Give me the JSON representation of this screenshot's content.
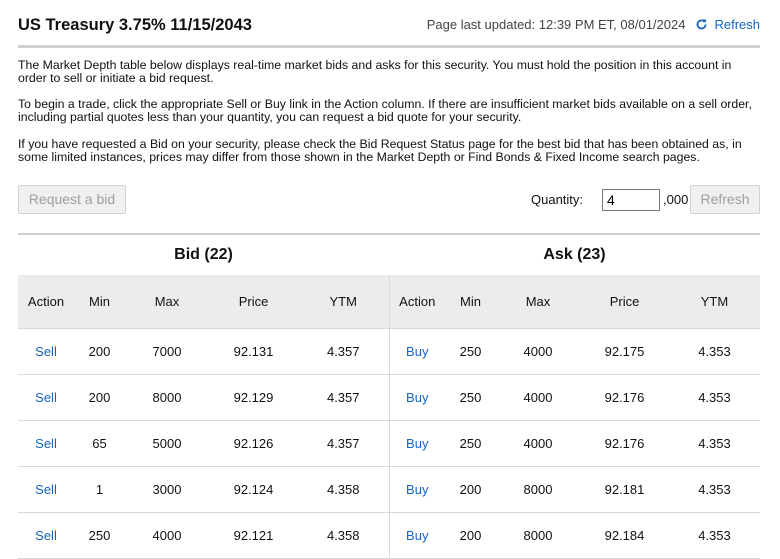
{
  "header": {
    "title": "US Treasury 3.75% 11/15/2043",
    "last_updated": "Page last updated: 12:39 PM ET, 08/01/2024",
    "refresh_label": "Refresh"
  },
  "intro": {
    "p1": "The Market Depth table below displays real-time market bids and asks for this security. You must hold the position in this account in order to sell or initiate a bid request.",
    "p2": "To begin a trade, click the appropriate Sell or Buy link in the Action column. If there are insufficient market bids available on a sell order, including partial quotes less than your quantity, you can request a bid quote for your security.",
    "p3": "If you have requested a Bid on your security, please check the Bid Request Status page for the best bid that has been obtained as, in some limited instances, prices may differ from those shown in the Market Depth or Find Bonds & Fixed Income search pages."
  },
  "controls": {
    "request_bid_label": "Request a bid",
    "quantity_label": "Quantity:",
    "quantity_value": "4",
    "quantity_suffix": ",000",
    "refresh_button_label": "Refresh"
  },
  "bid": {
    "heading": "Bid (22)",
    "columns": [
      "Action",
      "Min",
      "Max",
      "Price",
      "YTM"
    ],
    "rows": [
      {
        "action": "Sell",
        "min": "200",
        "max": "7000",
        "price": "92.131",
        "ytm": "4.357"
      },
      {
        "action": "Sell",
        "min": "200",
        "max": "8000",
        "price": "92.129",
        "ytm": "4.357"
      },
      {
        "action": "Sell",
        "min": "65",
        "max": "5000",
        "price": "92.126",
        "ytm": "4.357"
      },
      {
        "action": "Sell",
        "min": "1",
        "max": "3000",
        "price": "92.124",
        "ytm": "4.358"
      },
      {
        "action": "Sell",
        "min": "250",
        "max": "4000",
        "price": "92.121",
        "ytm": "4.358"
      }
    ]
  },
  "ask": {
    "heading": "Ask (23)",
    "columns": [
      "Action",
      "Min",
      "Max",
      "Price",
      "YTM"
    ],
    "rows": [
      {
        "action": "Buy",
        "min": "250",
        "max": "4000",
        "price": "92.175",
        "ytm": "4.353"
      },
      {
        "action": "Buy",
        "min": "250",
        "max": "4000",
        "price": "92.176",
        "ytm": "4.353"
      },
      {
        "action": "Buy",
        "min": "250",
        "max": "4000",
        "price": "92.176",
        "ytm": "4.353"
      },
      {
        "action": "Buy",
        "min": "200",
        "max": "8000",
        "price": "92.181",
        "ytm": "4.353"
      },
      {
        "action": "Buy",
        "min": "200",
        "max": "8000",
        "price": "92.184",
        "ytm": "4.353"
      }
    ]
  },
  "colors": {
    "link": "#1565c0",
    "header_bg": "#ececec",
    "rule": "#cfcfcf"
  }
}
